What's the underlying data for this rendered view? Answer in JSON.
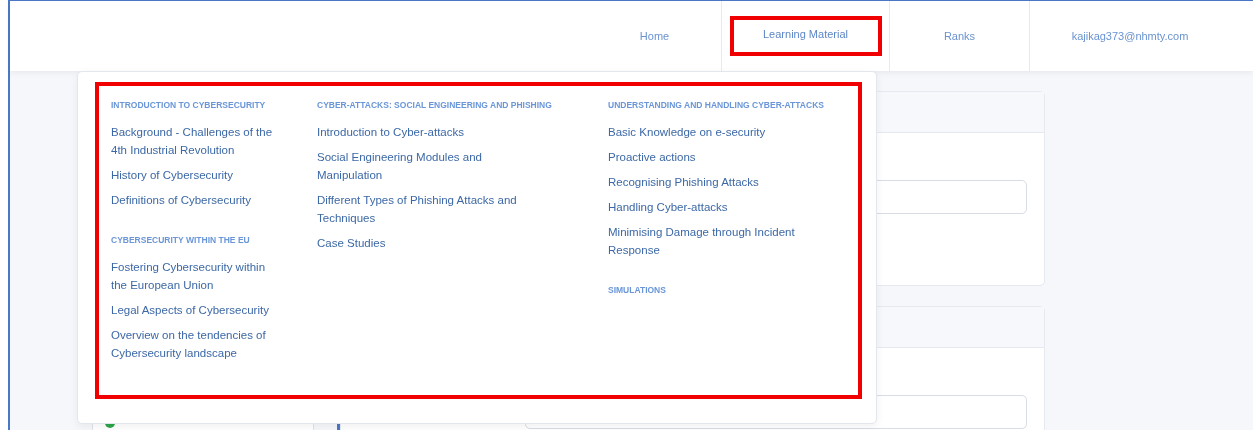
{
  "nav": {
    "items": [
      {
        "label": "Home",
        "selected": false,
        "highlighted": false
      },
      {
        "label": "Learning Material",
        "selected": true,
        "highlighted": true
      },
      {
        "label": "Ranks",
        "selected": false,
        "highlighted": false
      },
      {
        "label": "kajikag373@nhmty.com",
        "selected": false,
        "highlighted": false
      }
    ]
  },
  "dropdown": {
    "highlighted": true,
    "columns": [
      {
        "sections": [
          {
            "heading": "INTRODUCTION TO CYBERSECURITY",
            "links": [
              "Background - Challenges of the 4th Industrial Revolution",
              "History of Cybersecurity",
              "Definitions of Cybersecurity"
            ]
          },
          {
            "heading": "CYBERSECURITY WITHIN THE EU",
            "links": [
              "Fostering Cybersecurity within the European Union",
              "Legal Aspects of Cybersecurity",
              "Overview on the tendencies of Cybersecurity landscape"
            ]
          }
        ]
      },
      {
        "sections": [
          {
            "heading": "CYBER-ATTACKS: SOCIAL ENGINEERING AND PHISHING",
            "links": [
              "Introduction to Cyber-attacks",
              "Social Engineering Modules and Manipulation",
              "Different Types of Phishing Attacks and Techniques",
              "Case Studies"
            ]
          }
        ]
      },
      {
        "sections": [
          {
            "heading": "UNDERSTANDING AND HANDLING CYBER-ATTACKS",
            "links": [
              "Basic Knowledge on e-security",
              "Proactive actions",
              "Recognising Phishing Attacks",
              "Handling Cyber-attacks",
              "Minimising Damage through Incident Response"
            ]
          },
          {
            "heading": "SIMULATIONS"
          }
        ]
      }
    ]
  }
}
